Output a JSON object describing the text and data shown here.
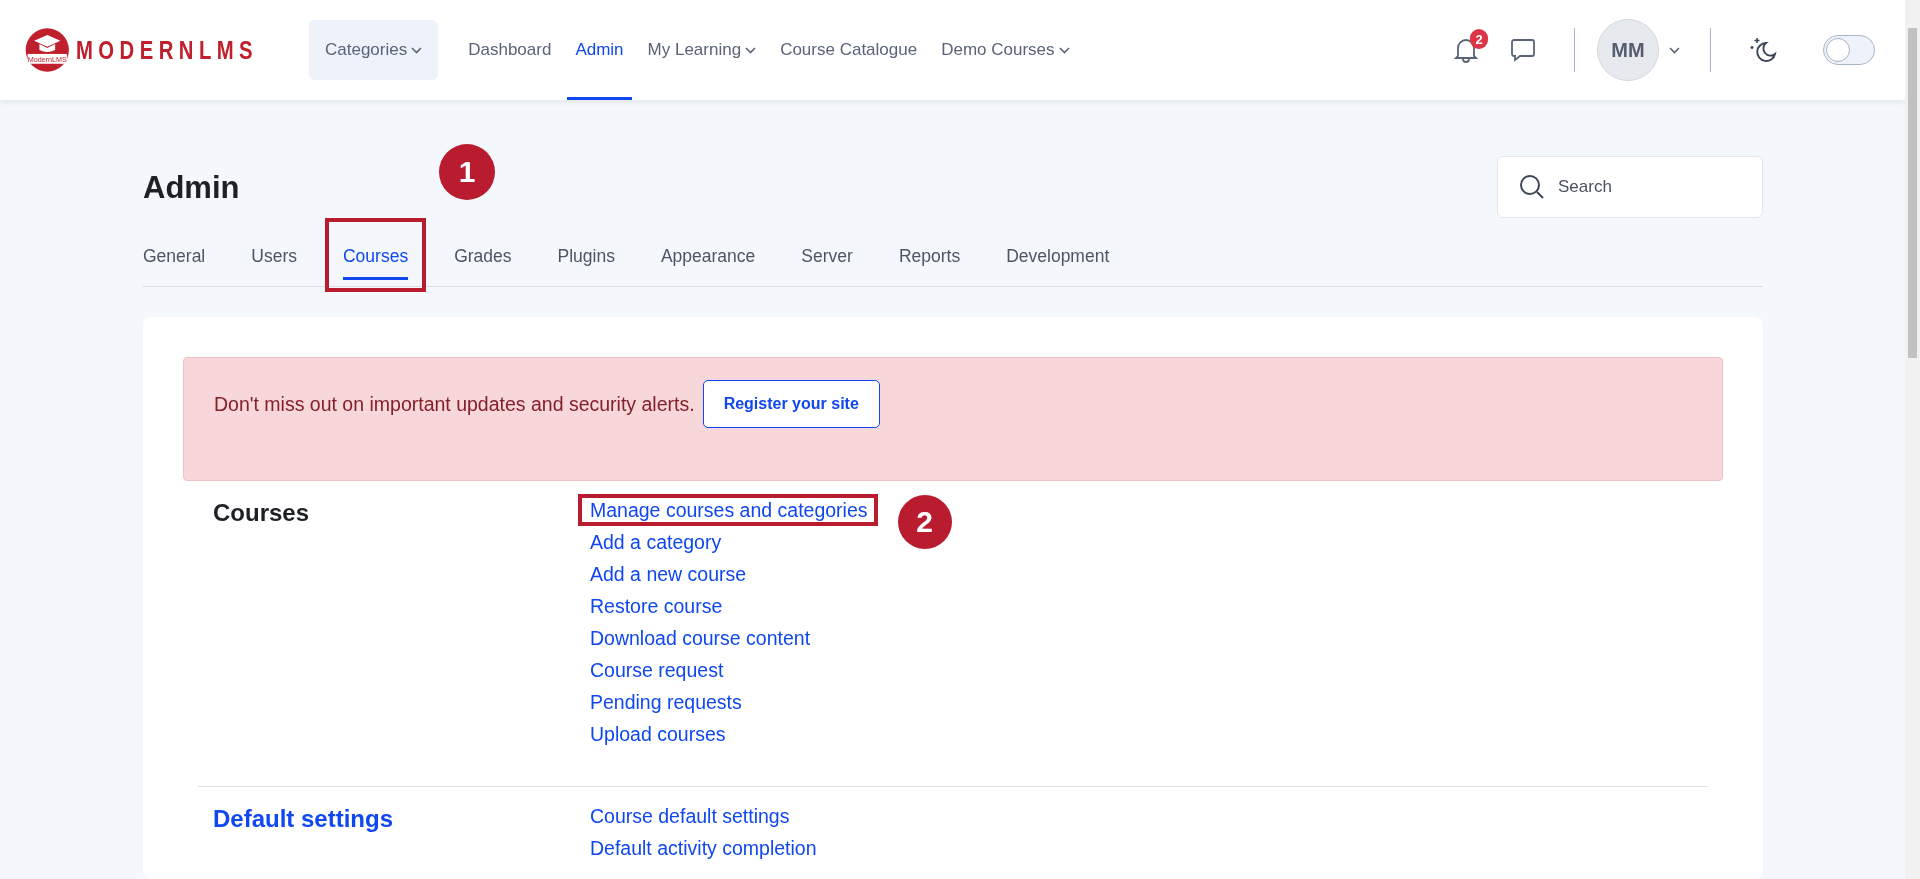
{
  "header": {
    "logo": {
      "name": "MODERNLMS",
      "badge_text": "ModernLMS"
    },
    "nav": [
      {
        "label": "Categories",
        "dropdown": true,
        "selected": false,
        "boxed": true
      },
      {
        "label": "Dashboard",
        "dropdown": false,
        "selected": false,
        "boxed": false
      },
      {
        "label": "Admin",
        "dropdown": false,
        "selected": true,
        "boxed": false
      },
      {
        "label": "My Learning",
        "dropdown": true,
        "selected": false,
        "boxed": false
      },
      {
        "label": "Course Catalogue",
        "dropdown": false,
        "selected": false,
        "boxed": false
      },
      {
        "label": "Demo Courses",
        "dropdown": true,
        "selected": false,
        "boxed": false
      }
    ],
    "notifications": {
      "count": "2"
    },
    "user": {
      "initials": "MM"
    },
    "dark_mode": {
      "on": false
    }
  },
  "page": {
    "title": "Admin",
    "search": {
      "placeholder": "Search"
    },
    "tabs": [
      {
        "label": "General",
        "selected": false
      },
      {
        "label": "Users",
        "selected": false
      },
      {
        "label": "Courses",
        "selected": true,
        "marker": "1"
      },
      {
        "label": "Grades",
        "selected": false
      },
      {
        "label": "Plugins",
        "selected": false
      },
      {
        "label": "Appearance",
        "selected": false
      },
      {
        "label": "Server",
        "selected": false
      },
      {
        "label": "Reports",
        "selected": false
      },
      {
        "label": "Development",
        "selected": false
      }
    ]
  },
  "alert": {
    "text": "Don't miss out on important updates and security alerts.",
    "button": "Register your site"
  },
  "sections": [
    {
      "title": "Courses",
      "kind": "heading",
      "links": [
        {
          "label": "Manage courses and categories",
          "marker": "2"
        },
        {
          "label": "Add a category"
        },
        {
          "label": "Add a new course"
        },
        {
          "label": "Restore course"
        },
        {
          "label": "Download course content"
        },
        {
          "label": "Course request"
        },
        {
          "label": "Pending requests"
        },
        {
          "label": "Upload courses"
        }
      ]
    },
    {
      "title": "Default settings",
      "kind": "link",
      "links": [
        {
          "label": "Course default settings"
        },
        {
          "label": "Default activity completion"
        }
      ]
    }
  ]
}
